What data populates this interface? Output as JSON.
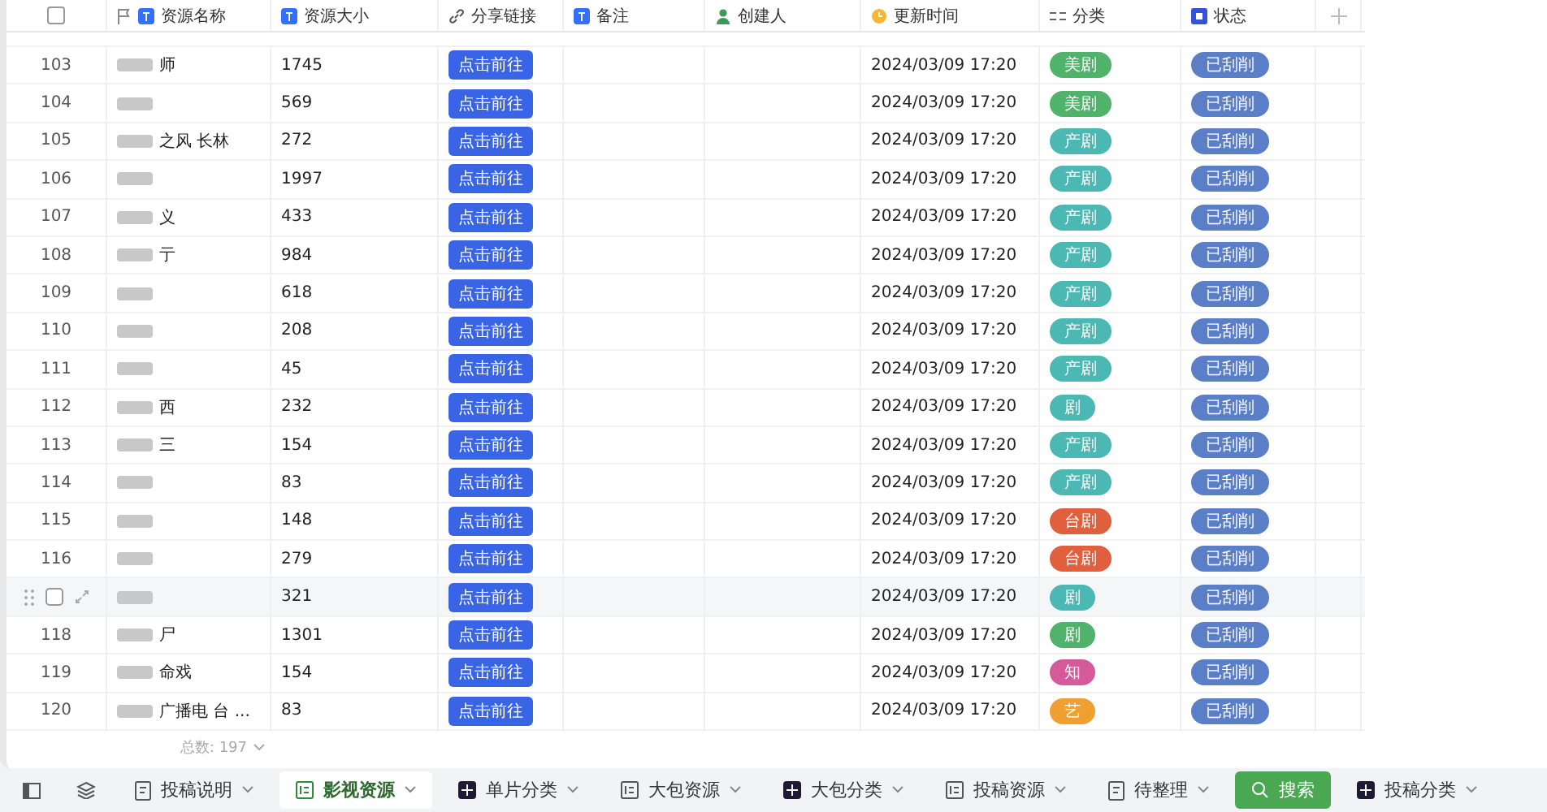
{
  "table": {
    "select_all": {
      "checked": false
    },
    "columns": [
      {
        "label": "资源名称",
        "kind": "text",
        "flag": true
      },
      {
        "label": "资源大小",
        "kind": "text",
        "flag": false
      },
      {
        "label": "分享链接",
        "kind": "link",
        "flag": false
      },
      {
        "label": "备注",
        "kind": "text",
        "flag": false
      },
      {
        "label": "创建人",
        "kind": "person",
        "flag": false
      },
      {
        "label": "更新时间",
        "kind": "time",
        "flag": false
      },
      {
        "label": "分类",
        "kind": "options",
        "flag": false
      },
      {
        "label": "状态",
        "kind": "status",
        "flag": false
      }
    ],
    "rows": [
      {
        "index": "103",
        "name": "师",
        "size": "1745",
        "link": "点击前往",
        "time": "2024/03/09 17:20",
        "category": "美剧",
        "color": "#4fb36b",
        "status": "已刮削",
        "hovered": false
      },
      {
        "index": "104",
        "name": "",
        "size": "569",
        "link": "点击前往",
        "time": "2024/03/09 17:20",
        "category": "美剧",
        "color": "#4fb36b",
        "status": "已刮削",
        "hovered": false
      },
      {
        "index": "105",
        "name": "之风 长林",
        "size": "272",
        "link": "点击前往",
        "time": "2024/03/09 17:20",
        "category": "产剧",
        "color": "#4bb8b3",
        "status": "已刮削",
        "hovered": false
      },
      {
        "index": "106",
        "name": "",
        "size": "1997",
        "link": "点击前往",
        "time": "2024/03/09 17:20",
        "category": "产剧",
        "color": "#4bb8b3",
        "status": "已刮削",
        "hovered": false
      },
      {
        "index": "107",
        "name": "义",
        "size": "433",
        "link": "点击前往",
        "time": "2024/03/09 17:20",
        "category": "产剧",
        "color": "#4bb8b3",
        "status": "已刮削",
        "hovered": false
      },
      {
        "index": "108",
        "name": "亍",
        "size": "984",
        "link": "点击前往",
        "time": "2024/03/09 17:20",
        "category": "产剧",
        "color": "#4bb8b3",
        "status": "已刮削",
        "hovered": false
      },
      {
        "index": "109",
        "name": "",
        "size": "618",
        "link": "点击前往",
        "time": "2024/03/09 17:20",
        "category": "产剧",
        "color": "#4bb8b3",
        "status": "已刮削",
        "hovered": false
      },
      {
        "index": "110",
        "name": "",
        "size": "208",
        "link": "点击前往",
        "time": "2024/03/09 17:20",
        "category": "产剧",
        "color": "#4bb8b3",
        "status": "已刮削",
        "hovered": false
      },
      {
        "index": "111",
        "name": "",
        "size": "45",
        "link": "点击前往",
        "time": "2024/03/09 17:20",
        "category": "产剧",
        "color": "#4bb8b3",
        "status": "已刮削",
        "hovered": false
      },
      {
        "index": "112",
        "name": "西",
        "size": "232",
        "link": "点击前往",
        "time": "2024/03/09 17:20",
        "category": "剧",
        "color": "#4bb8b3",
        "status": "已刮削",
        "hovered": false
      },
      {
        "index": "113",
        "name": "三",
        "size": "154",
        "link": "点击前往",
        "time": "2024/03/09 17:20",
        "category": "产剧",
        "color": "#4bb8b3",
        "status": "已刮削",
        "hovered": false
      },
      {
        "index": "114",
        "name": "",
        "size": "83",
        "link": "点击前往",
        "time": "2024/03/09 17:20",
        "category": "产剧",
        "color": "#4bb8b3",
        "status": "已刮削",
        "hovered": false
      },
      {
        "index": "115",
        "name": "",
        "size": "148",
        "link": "点击前往",
        "time": "2024/03/09 17:20",
        "category": "台剧",
        "color": "#e0603e",
        "status": "已刮削",
        "hovered": false
      },
      {
        "index": "116",
        "name": "",
        "size": "279",
        "link": "点击前往",
        "time": "2024/03/09 17:20",
        "category": "台剧",
        "color": "#e0603e",
        "status": "已刮削",
        "hovered": false
      },
      {
        "name": "",
        "size": "321",
        "link": "点击前往",
        "time": "2024/03/09 17:20",
        "category": "剧",
        "color": "#4bb8b3",
        "status": "已刮削",
        "hovered": true,
        "checked": false
      },
      {
        "index": "118",
        "name": "尸",
        "size": "1301",
        "link": "点击前往",
        "time": "2024/03/09 17:20",
        "category": "剧",
        "color": "#4fb36b",
        "status": "已刮削",
        "hovered": false
      },
      {
        "index": "119",
        "name": "命戏",
        "size": "154",
        "link": "点击前往",
        "time": "2024/03/09 17:20",
        "category": "知",
        "color": "#d45a9a",
        "status": "已刮削",
        "hovered": false
      },
      {
        "index": "120",
        "name": "广播电 台 ...",
        "size": "83",
        "link": "点击前往",
        "time": "2024/03/09 17:20",
        "category": "艺",
        "color": "#f0a030",
        "status": "已刮削",
        "hovered": false
      }
    ],
    "total": "总数: 197"
  },
  "sheet_tabs": [
    {
      "label": "投稿说明",
      "kind": "doc",
      "selected": false
    },
    {
      "label": "影视资源",
      "kind": "table",
      "selected": true
    },
    {
      "label": "单片分类",
      "kind": "grid",
      "selected": false
    },
    {
      "label": "大包资源",
      "kind": "table",
      "selected": false
    },
    {
      "label": "大包分类",
      "kind": "grid",
      "selected": false
    },
    {
      "label": "投稿资源",
      "kind": "table",
      "selected": false
    },
    {
      "label": "待整理",
      "kind": "doc",
      "selected": false
    },
    {
      "label": "搜索",
      "kind": "search",
      "selected": false
    },
    {
      "label": "投稿分类",
      "kind": "grid",
      "selected": false
    }
  ]
}
